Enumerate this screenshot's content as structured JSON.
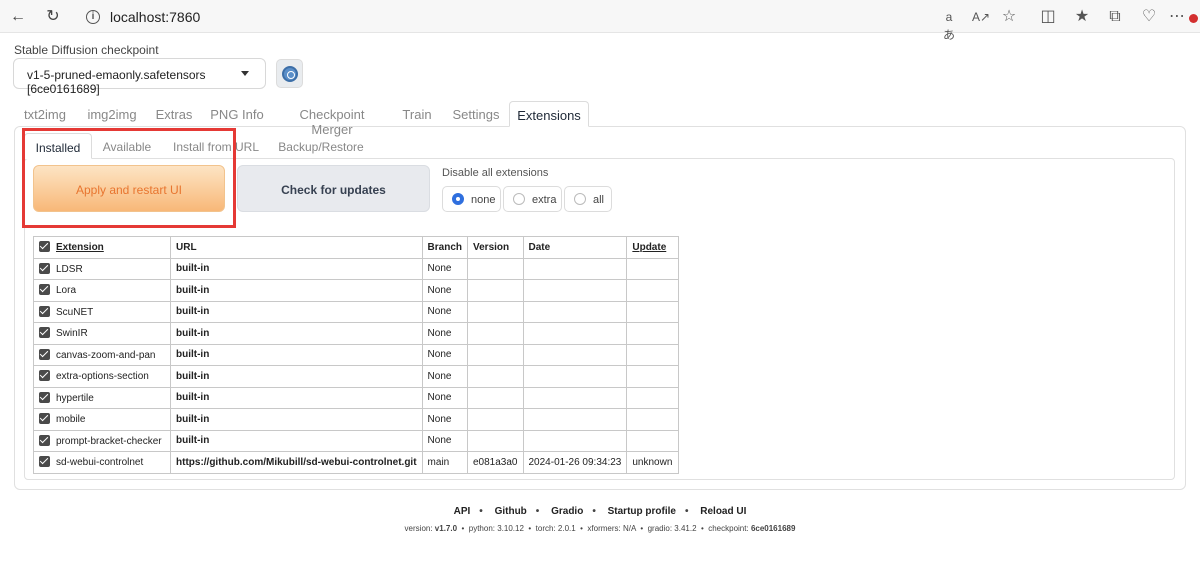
{
  "browser": {
    "url": "localhost:7860",
    "icons": [
      "back-icon",
      "reload-icon",
      "info-icon",
      "translate-icon",
      "read-aloud-icon",
      "favorite-star-icon",
      "split-screen-icon",
      "favorites-icon",
      "collections-icon",
      "extensions-icon",
      "more-icon"
    ]
  },
  "checkpoint": {
    "label": "Stable Diffusion checkpoint",
    "value": "v1-5-pruned-emaonly.safetensors [6ce0161689]"
  },
  "main_tabs": [
    "txt2img",
    "img2img",
    "Extras",
    "PNG Info",
    "Checkpoint Merger",
    "Train",
    "Settings",
    "Extensions"
  ],
  "main_tab_active": "Extensions",
  "sub_tabs": [
    "Installed",
    "Available",
    "Install from URL",
    "Backup/Restore"
  ],
  "sub_tab_active": "Installed",
  "buttons": {
    "apply": "Apply and restart UI",
    "check": "Check for updates"
  },
  "disable": {
    "label": "Disable all extensions",
    "options": [
      "none",
      "extra",
      "all"
    ],
    "selected": "none"
  },
  "table": {
    "headers": [
      "Extension",
      "URL",
      "Branch",
      "Version",
      "Date",
      "Update"
    ],
    "rows": [
      {
        "name": "LDSR",
        "url": "built-in",
        "branch": "None",
        "version": "",
        "date": "",
        "update": ""
      },
      {
        "name": "Lora",
        "url": "built-in",
        "branch": "None",
        "version": "",
        "date": "",
        "update": ""
      },
      {
        "name": "ScuNET",
        "url": "built-in",
        "branch": "None",
        "version": "",
        "date": "",
        "update": ""
      },
      {
        "name": "SwinIR",
        "url": "built-in",
        "branch": "None",
        "version": "",
        "date": "",
        "update": ""
      },
      {
        "name": "canvas-zoom-and-pan",
        "url": "built-in",
        "branch": "None",
        "version": "",
        "date": "",
        "update": ""
      },
      {
        "name": "extra-options-section",
        "url": "built-in",
        "branch": "None",
        "version": "",
        "date": "",
        "update": ""
      },
      {
        "name": "hypertile",
        "url": "built-in",
        "branch": "None",
        "version": "",
        "date": "",
        "update": ""
      },
      {
        "name": "mobile",
        "url": "built-in",
        "branch": "None",
        "version": "",
        "date": "",
        "update": ""
      },
      {
        "name": "prompt-bracket-checker",
        "url": "built-in",
        "branch": "None",
        "version": "",
        "date": "",
        "update": ""
      },
      {
        "name": "sd-webui-controlnet",
        "url": "https://github.com/Mikubill/sd-webui-controlnet.git",
        "branch": "main",
        "version": "e081a3a0",
        "date": "2024-01-26 09:34:23",
        "update": "unknown"
      }
    ]
  },
  "footer": {
    "links": [
      "API",
      "Github",
      "Gradio",
      "Startup profile",
      "Reload UI"
    ],
    "version_label": "version:",
    "version": "v1.7.0",
    "python_label": "python:",
    "python": "3.10.12",
    "torch_label": "torch:",
    "torch": "2.0.1",
    "xformers_label": "xformers:",
    "xformers": "N/A",
    "gradio_label": "gradio:",
    "gradio": "3.41.2",
    "checkpoint_label": "checkpoint:",
    "checkpoint": "6ce0161689"
  },
  "colors": {
    "highlight": "#e53935",
    "apply_text": "#e8752f",
    "radio_selected": "#2f6fde"
  }
}
